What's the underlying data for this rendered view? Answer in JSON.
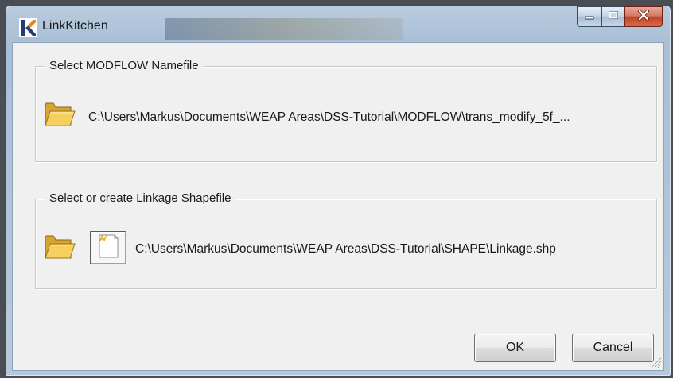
{
  "window": {
    "title": "LinkKitchen",
    "icon": "linkkitchen-app-icon"
  },
  "caption_buttons": [
    {
      "name": "minimize",
      "icon": "minimize-icon"
    },
    {
      "name": "maximize",
      "icon": "maximize-icon"
    },
    {
      "name": "close",
      "icon": "close-x-icon"
    }
  ],
  "modflow_group": {
    "label": "Select MODFLOW Namefile",
    "open_icon": "open-folder-icon",
    "path": "C:\\Users\\Markus\\Documents\\WEAP Areas\\DSS-Tutorial\\MODFLOW\\trans_modify_5f_..."
  },
  "shapefile_group": {
    "label": "Select or create Linkage Shapefile",
    "open_icon": "open-folder-icon",
    "new_icon": "new-file-icon",
    "path": "C:\\Users\\Markus\\Documents\\WEAP Areas\\DSS-Tutorial\\SHAPE\\Linkage.shp"
  },
  "buttons": {
    "ok": "OK",
    "cancel": "Cancel"
  },
  "colors": {
    "frame": "#a9bfd6",
    "client": "#f0f0f0",
    "close_button": "#c4452a",
    "folder": "#f2c14e"
  }
}
